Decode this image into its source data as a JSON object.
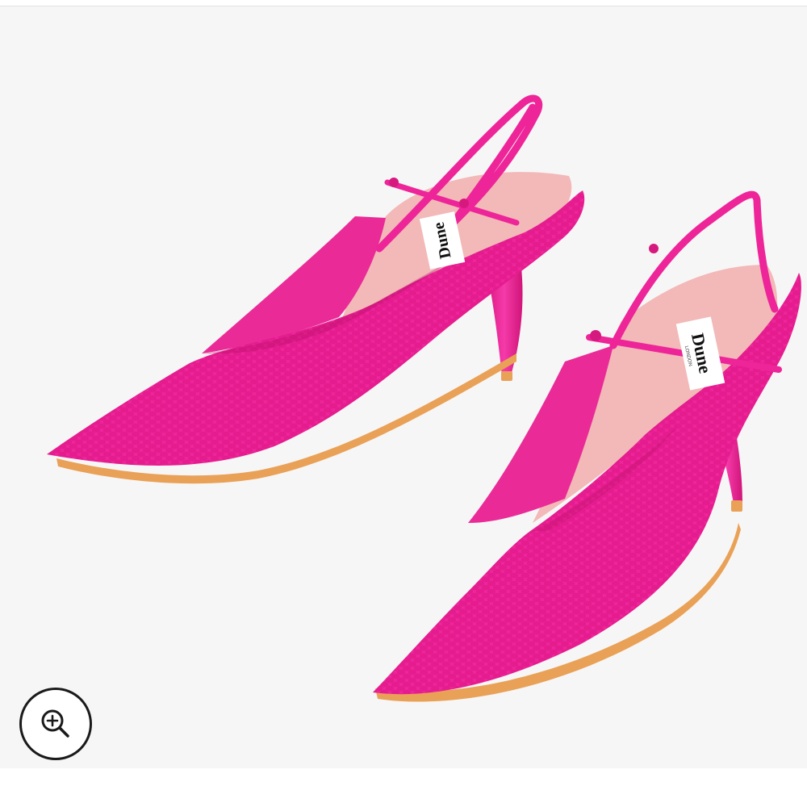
{
  "image": {
    "subject": "pink-slingback-pumps",
    "brand_label": "Dune",
    "brand_sublabel": "LONDON"
  },
  "controls": {
    "zoom_icon": "magnifier-plus-icon"
  },
  "colors": {
    "background": "#f7f6f6",
    "shoe_pink": "#f0249b",
    "shoe_pink_dark": "#d4167f",
    "lining": "#f2b9b8",
    "sole": "#e9a157"
  }
}
